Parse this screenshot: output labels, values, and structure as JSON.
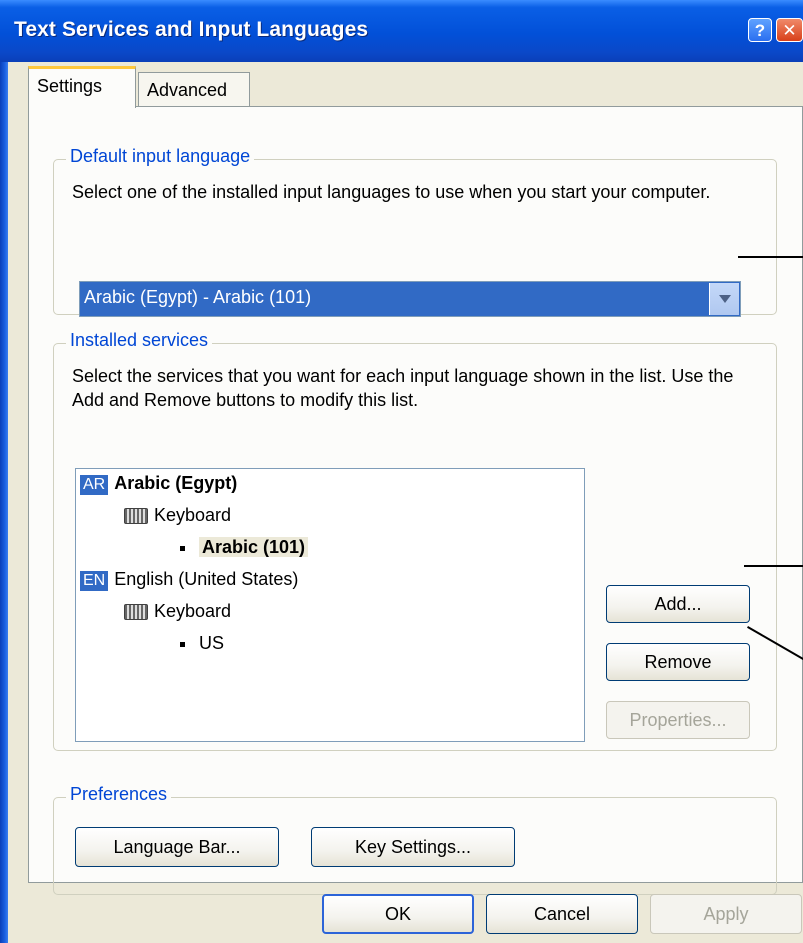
{
  "window": {
    "title": "Text Services and Input Languages",
    "help_glyph": "?",
    "close_glyph": "✕"
  },
  "tabs": [
    {
      "label": "Settings",
      "active": true
    },
    {
      "label": "Advanced",
      "active": false
    }
  ],
  "default_input_language": {
    "legend": "Default input language",
    "description": "Select one of the installed input languages to use when you start your computer.",
    "selected_value": "Arabic (Egypt) - Arabic (101)"
  },
  "installed_services": {
    "legend": "Installed services",
    "description": "Select the services that you want for each input language shown in the list. Use the Add and Remove buttons to modify this list.",
    "tree": [
      {
        "badge": "AR",
        "label": "Arabic (Egypt)",
        "bold": true
      },
      {
        "label": "Keyboard"
      },
      {
        "label": "Arabic (101)",
        "selected": true
      },
      {
        "badge": "EN",
        "label": "English (United States)"
      },
      {
        "label": "Keyboard"
      },
      {
        "label": "US"
      }
    ],
    "buttons": {
      "add": "Add...",
      "remove": "Remove",
      "properties": "Properties..."
    }
  },
  "preferences": {
    "legend": "Preferences",
    "language_bar": "Language Bar...",
    "key_settings": "Key Settings..."
  },
  "footer": {
    "ok": "OK",
    "cancel": "Cancel",
    "apply": "Apply"
  },
  "colors": {
    "title_bar": "#0250d8",
    "legend_text": "#0046d5",
    "selection": "#316ac5",
    "dialog_bg": "#ece9d8"
  }
}
